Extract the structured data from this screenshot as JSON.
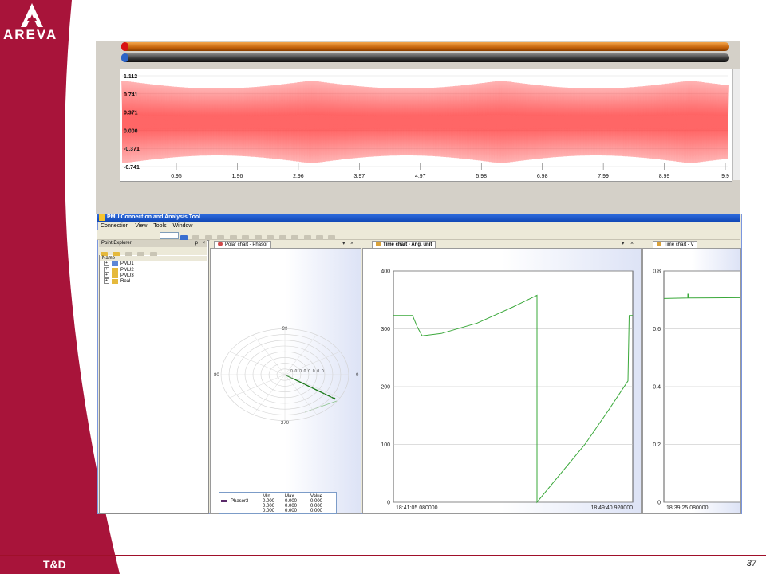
{
  "brand": {
    "logo_text": "AREVA",
    "footer_text": "T&D",
    "page_number": "37",
    "band_color": "#a8143a"
  },
  "waveform": {
    "y_ticks": [
      "1.112",
      "0.741",
      "0.371",
      "0.000",
      "-0.371",
      "-0.741"
    ],
    "x_ticks": [
      "0.95",
      "1.96",
      "2.96",
      "3.97",
      "4.97",
      "5.98",
      "6.98",
      "7.99",
      "8.99",
      "9.9"
    ],
    "color": "#ff2a2a"
  },
  "app": {
    "title": "PMU Connection and Analysis Tool",
    "menu": [
      "Connection",
      "View",
      "Tools",
      "Window"
    ]
  },
  "explorer": {
    "title": "Point Explorer",
    "pin": "p",
    "close": "×",
    "column": "Name",
    "items": [
      "PMU1",
      "PMU2",
      "PMU3",
      "Real"
    ]
  },
  "polar": {
    "tab": "Polar chart - Phasor",
    "angle_labels": {
      "top": "90",
      "left": "80",
      "bottom": "270",
      "right": "0"
    },
    "ring_labels": "0.  0.  0.  0.  0.  0.  0.  0.",
    "table": {
      "headers": [
        "Min.",
        "Max.",
        "Value"
      ],
      "rows": [
        {
          "name": "Phasor3",
          "min": "0.000",
          "max": "0.000",
          "value": "0.000"
        },
        {
          "name": "",
          "min": "0.000",
          "max": "0.000",
          "value": "0.000"
        },
        {
          "name": "",
          "min": "0.000",
          "max": "0.000",
          "value": "0.000"
        }
      ]
    },
    "phasor_color": "#1a7a1a"
  },
  "chart_data": [
    {
      "type": "line",
      "title": "Time chart - Ang. unit",
      "y_ticks": [
        "400",
        "300",
        "200",
        "100",
        "0"
      ],
      "ylim": [
        0,
        400
      ],
      "x_labels": [
        "18:41:05.080000",
        "18:49:40.920000"
      ],
      "series": [
        {
          "color": "#3aa83a",
          "x": [
            0,
            0.08,
            0.1,
            0.12,
            0.2,
            0.35,
            0.5,
            0.6,
            0.6,
            0.8,
            0.9,
            0.98,
            0.985,
            1
          ],
          "y": [
            323,
            323,
            303,
            288,
            292,
            310,
            338,
            358,
            0,
            100,
            160,
            210,
            323,
            323
          ]
        }
      ],
      "xlim": [
        0,
        1
      ]
    },
    {
      "type": "line",
      "title": "Time chart - V",
      "y_ticks": [
        "0.8",
        "0.6",
        "0.4",
        "0.2",
        "0"
      ],
      "ylim": [
        0,
        0.8
      ],
      "x_labels": [
        "18:39:25.080000",
        ""
      ],
      "series": [
        {
          "color": "#3aa83a",
          "x": [
            0,
            0.3,
            0.3,
            0.31,
            0.31,
            1
          ],
          "y": [
            0.705,
            0.707,
            0.72,
            0.72,
            0.707,
            0.708
          ]
        }
      ],
      "xlim": [
        0,
        1
      ]
    }
  ]
}
